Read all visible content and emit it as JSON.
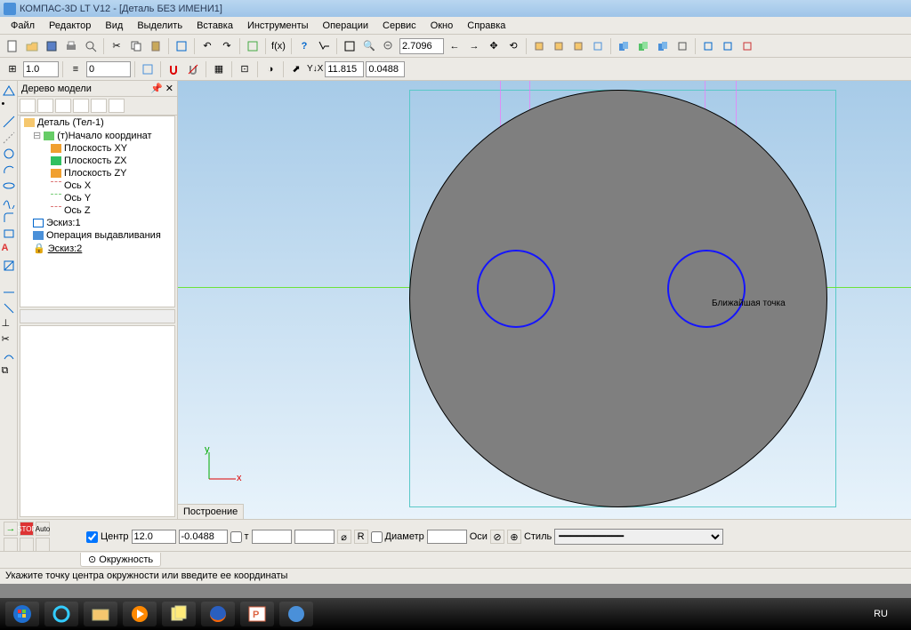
{
  "title": "КОМПАС-3D LT V12 - [Деталь БЕЗ ИМЕНИ1]",
  "menu": [
    "Файл",
    "Редактор",
    "Вид",
    "Выделить",
    "Вставка",
    "Инструменты",
    "Операции",
    "Сервис",
    "Окно",
    "Справка"
  ],
  "toolbar1": {
    "zoom": "2.7096"
  },
  "toolbar2": {
    "step": "1.0",
    "style": "0",
    "coordX": "11.815",
    "coordY": "0.0488"
  },
  "tree": {
    "title": "Дерево модели",
    "root": "Деталь (Тел-1)",
    "origin": "(т)Начало координат",
    "planes": [
      "Плоскость XY",
      "Плоскость ZX",
      "Плоскость ZY"
    ],
    "axes": [
      "Ось X",
      "Ось Y",
      "Ось Z"
    ],
    "sketch1": "Эскиз:1",
    "extrude": "Операция выдавливания",
    "sketch2": "Эскиз:2"
  },
  "canvas": {
    "axis_x": "x",
    "axis_y": "y",
    "hint": "Ближайшая точка"
  },
  "bottom_tab": "Построение",
  "params": {
    "center_label": "Центр",
    "center_x": "12.0",
    "center_y": "-0.0488",
    "t_label": "т",
    "diam_check": "R",
    "diam_label": "Диаметр",
    "axes_label": "Оси",
    "style_label": "Стиль",
    "tab": "Окружность"
  },
  "status": "Укажите точку центра окружности или введите ее координаты",
  "taskbar": {
    "lang": "RU"
  }
}
